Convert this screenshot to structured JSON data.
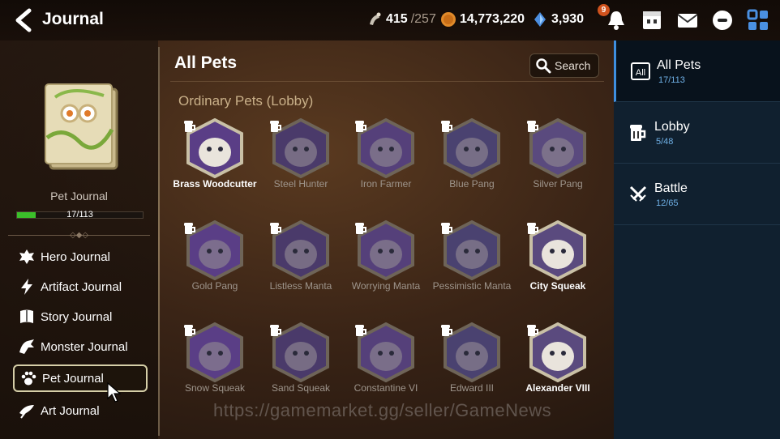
{
  "header": {
    "title": "Journal",
    "resources": [
      {
        "icon": "stamina-icon",
        "value": "415",
        "max": "/257"
      },
      {
        "icon": "gold-icon",
        "value": "14,773,220"
      },
      {
        "icon": "skystone-icon",
        "value": "3,930"
      }
    ],
    "notification_count": "9",
    "icons": [
      "bell-icon",
      "shop-icon",
      "mail-icon",
      "chat-icon",
      "menu-grid-icon"
    ]
  },
  "sidebar": {
    "journal_name": "Pet Journal",
    "progress_text": "17/113",
    "progress": 0.15,
    "items": [
      {
        "label": "Hero Journal",
        "icon": "hero-icon"
      },
      {
        "label": "Artifact Journal",
        "icon": "artifact-icon"
      },
      {
        "label": "Story Journal",
        "icon": "story-icon"
      },
      {
        "label": "Monster Journal",
        "icon": "monster-icon"
      },
      {
        "label": "Pet Journal",
        "icon": "paw-icon",
        "active": true
      },
      {
        "label": "Art Journal",
        "icon": "art-icon"
      }
    ]
  },
  "main": {
    "title": "All Pets",
    "search_label": "Search",
    "section_title": "Ordinary Pets (Lobby)",
    "pets": [
      {
        "name": "Brass Woodcutter",
        "owned": true
      },
      {
        "name": "Steel Hunter",
        "owned": false
      },
      {
        "name": "Iron Farmer",
        "owned": false
      },
      {
        "name": "Blue Pang",
        "owned": false
      },
      {
        "name": "Silver Pang",
        "owned": false
      },
      {
        "name": "Gold Pang",
        "owned": false
      },
      {
        "name": "Listless Manta",
        "owned": false
      },
      {
        "name": "Worrying Manta",
        "owned": false
      },
      {
        "name": "Pessimistic Manta",
        "owned": false
      },
      {
        "name": "City Squeak",
        "owned": true
      },
      {
        "name": "Snow Squeak",
        "owned": false
      },
      {
        "name": "Sand Squeak",
        "owned": false
      },
      {
        "name": "Constantine VI",
        "owned": false
      },
      {
        "name": "Edward III",
        "owned": false
      },
      {
        "name": "Alexander VIII",
        "owned": true
      }
    ]
  },
  "categories": [
    {
      "name": "All Pets",
      "count": "17/113",
      "icon": "all-icon",
      "active": true
    },
    {
      "name": "Lobby",
      "count": "5/48",
      "icon": "lobby-mug-icon"
    },
    {
      "name": "Battle",
      "count": "12/65",
      "icon": "battle-swords-icon"
    }
  ],
  "watermark": "https://gamemarket.gg/seller/GameNews",
  "colors": {
    "accent": "#3e8fe0",
    "progress": "#3bbf2a",
    "section": "#c9b089",
    "right_panel": "#10202f"
  }
}
